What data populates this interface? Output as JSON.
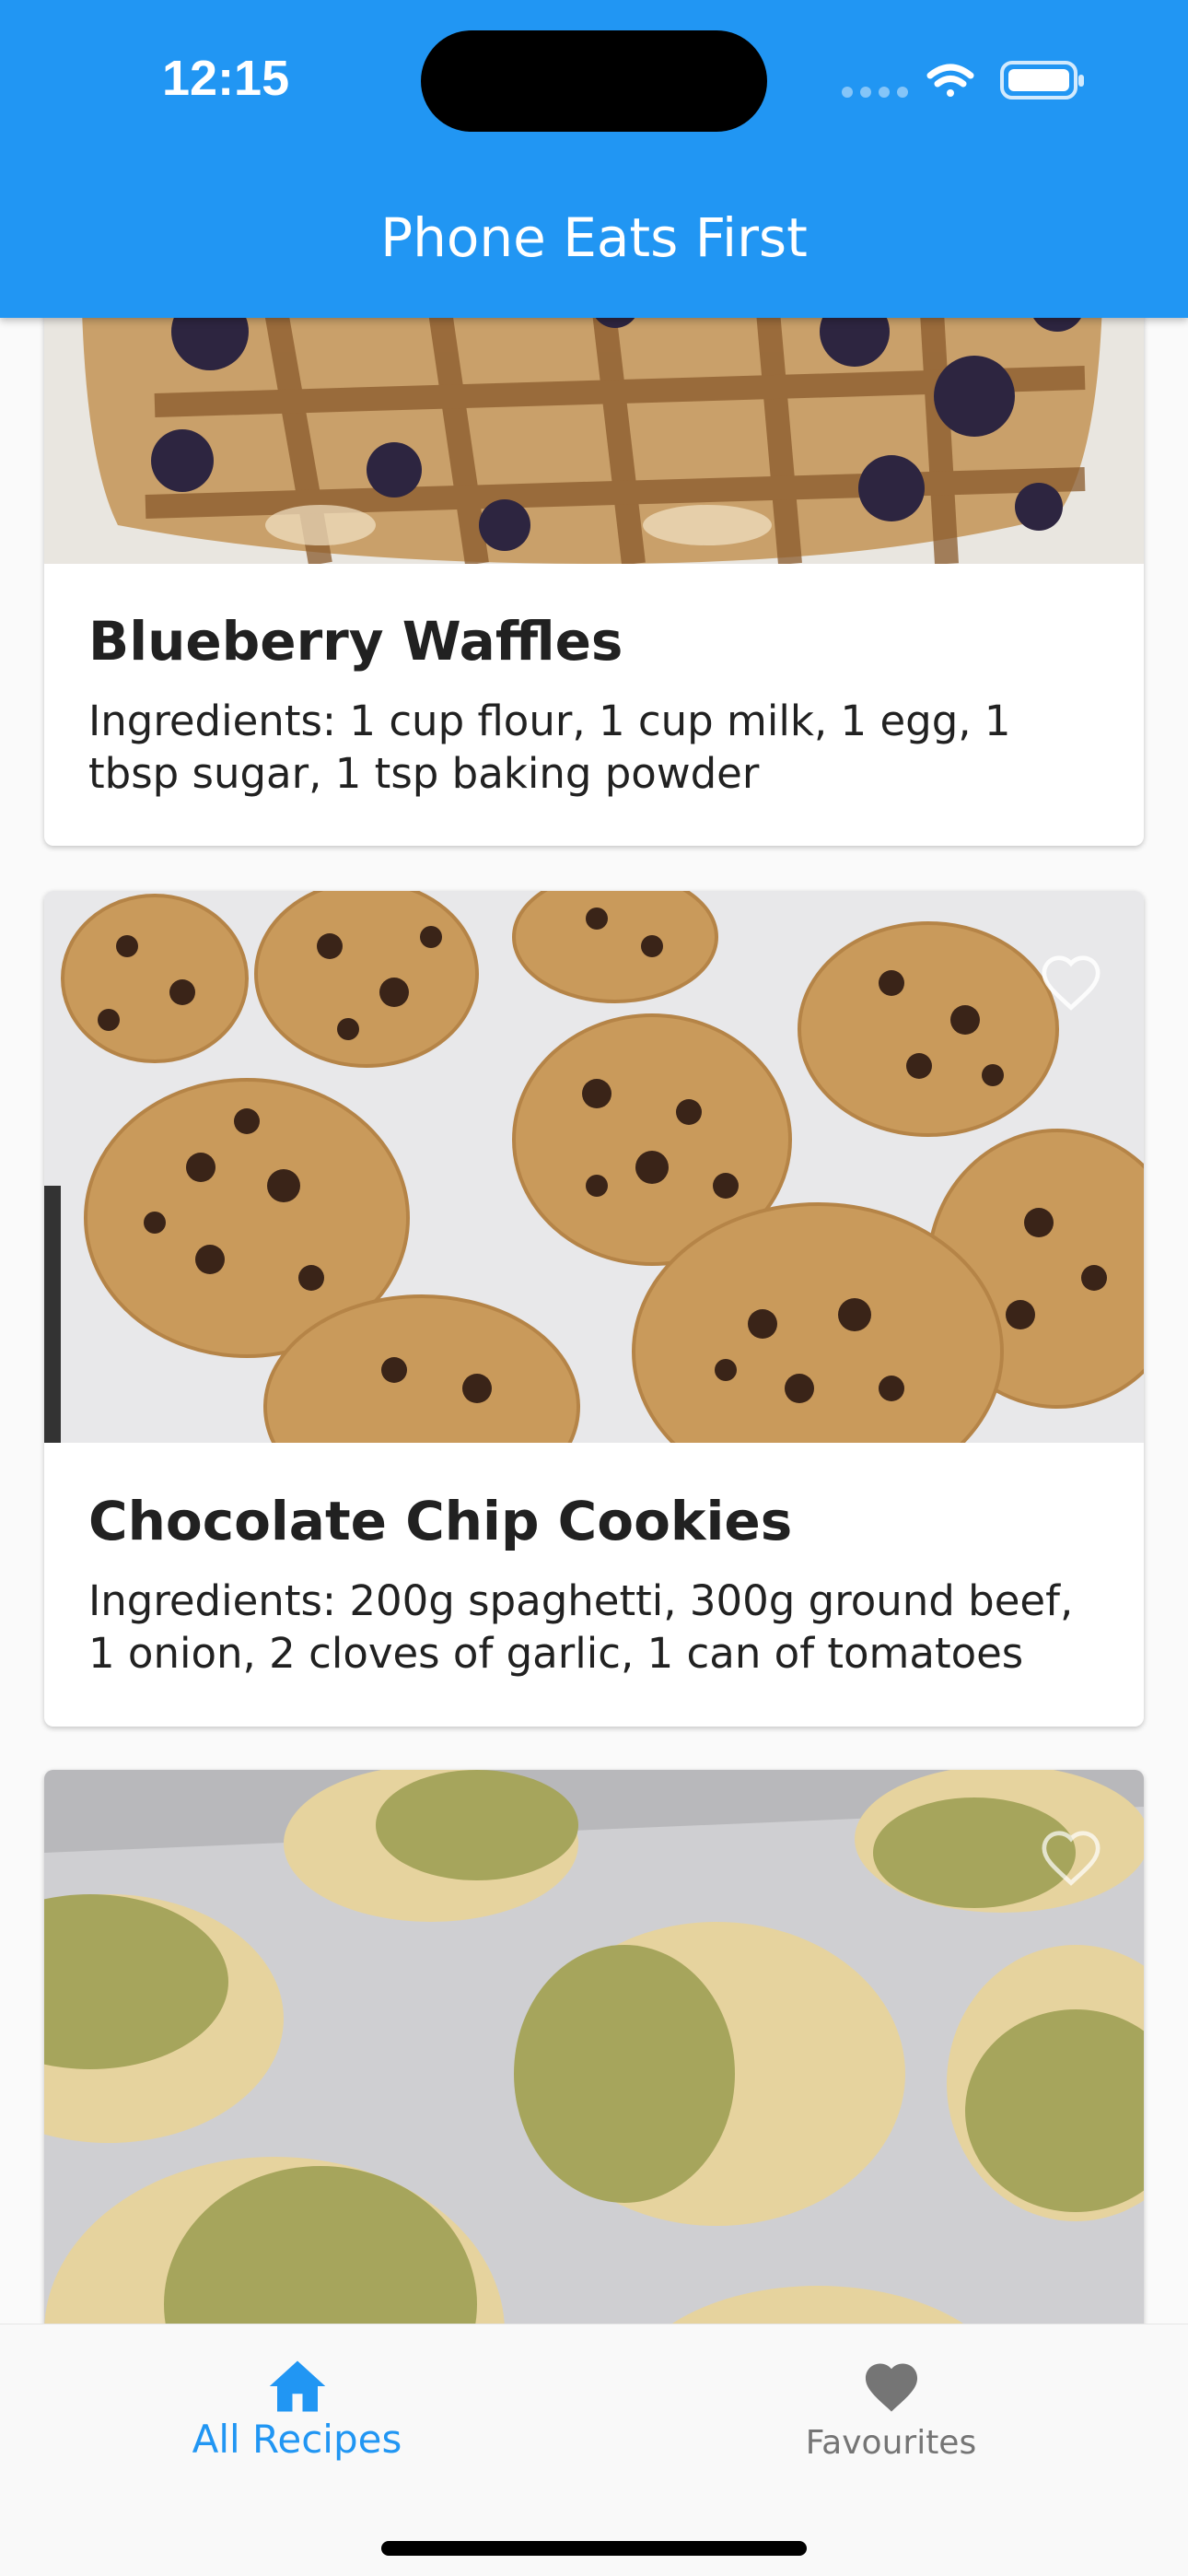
{
  "status_bar": {
    "time": "12:15",
    "icons": [
      "signal-icon",
      "wifi-icon",
      "battery-icon"
    ]
  },
  "app_bar": {
    "title": "Phone Eats First",
    "color": "#2196f3"
  },
  "recipes": [
    {
      "title": "Blueberry Waffles",
      "ingredients": "Ingredients: 1 cup flour, 1 cup milk, 1 egg, 1 tbsp sugar, 1 tsp baking powder",
      "photo": "blueberry-waffle-photo"
    },
    {
      "title": "Chocolate Chip Cookies",
      "ingredients": "Ingredients: 200g spaghetti, 300g ground beef, 1 onion, 2 cloves of garlic, 1 can of tomatoes",
      "photo": "chocolate-chip-cookies-photo",
      "favourite": false
    },
    {
      "photo": "matcha-cookies-photo",
      "favourite": false
    }
  ],
  "bottom_nav": {
    "items": [
      {
        "label": "All Recipes",
        "icon": "home-icon",
        "active": true
      },
      {
        "label": "Favourites",
        "icon": "heart-icon",
        "active": false
      }
    ],
    "active_color": "#2196f3",
    "inactive_color": "#757575"
  }
}
